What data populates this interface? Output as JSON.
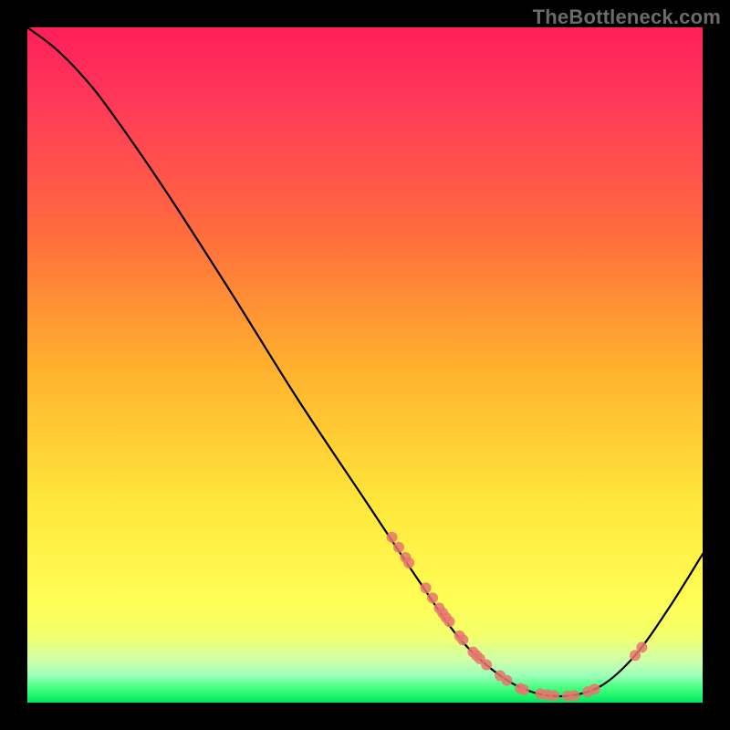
{
  "watermark": "TheBottleneck.com",
  "chart_data": {
    "type": "line",
    "title": "",
    "xlabel": "",
    "ylabel": "",
    "xlim": [
      0,
      100
    ],
    "ylim": [
      0,
      100
    ],
    "grid": false,
    "legend": false,
    "annotations": [],
    "curve_points": [
      {
        "x": 0,
        "y": 100
      },
      {
        "x": 4,
        "y": 97
      },
      {
        "x": 8,
        "y": 93
      },
      {
        "x": 12,
        "y": 88
      },
      {
        "x": 20,
        "y": 76.5
      },
      {
        "x": 30,
        "y": 61
      },
      {
        "x": 40,
        "y": 45
      },
      {
        "x": 50,
        "y": 30
      },
      {
        "x": 58,
        "y": 18
      },
      {
        "x": 64,
        "y": 9.5
      },
      {
        "x": 70,
        "y": 4
      },
      {
        "x": 75,
        "y": 1.5
      },
      {
        "x": 80,
        "y": 1.0
      },
      {
        "x": 85,
        "y": 2.5
      },
      {
        "x": 90,
        "y": 7
      },
      {
        "x": 95,
        "y": 14
      },
      {
        "x": 100,
        "y": 22
      }
    ],
    "highlight_dots": [
      {
        "x": 54,
        "y": 24.5
      },
      {
        "x": 55,
        "y": 23
      },
      {
        "x": 56,
        "y": 21.5
      },
      {
        "x": 56.5,
        "y": 20.7
      },
      {
        "x": 59,
        "y": 17
      },
      {
        "x": 60,
        "y": 15.5
      },
      {
        "x": 61,
        "y": 14
      },
      {
        "x": 61.5,
        "y": 13.3
      },
      {
        "x": 62,
        "y": 12.6
      },
      {
        "x": 62.5,
        "y": 12.0
      },
      {
        "x": 64,
        "y": 9.9
      },
      {
        "x": 64.5,
        "y": 9.3
      },
      {
        "x": 66,
        "y": 7.5
      },
      {
        "x": 66.5,
        "y": 7.0
      },
      {
        "x": 67,
        "y": 6.5
      },
      {
        "x": 68,
        "y": 5.6
      },
      {
        "x": 70,
        "y": 4.0
      },
      {
        "x": 71,
        "y": 3.3
      },
      {
        "x": 73,
        "y": 2.1
      },
      {
        "x": 73.5,
        "y": 1.9
      },
      {
        "x": 76,
        "y": 1.3
      },
      {
        "x": 77,
        "y": 1.15
      },
      {
        "x": 78,
        "y": 1.05
      },
      {
        "x": 80,
        "y": 1.0
      },
      {
        "x": 81,
        "y": 1.05
      },
      {
        "x": 83,
        "y": 1.6
      },
      {
        "x": 84,
        "y": 2.0
      },
      {
        "x": 90,
        "y": 7.0
      },
      {
        "x": 91,
        "y": 8.2
      }
    ],
    "colors": {
      "curve": "#000000",
      "dot": "#e8766e",
      "gradient_top": "#ff1f5a",
      "gradient_mid": "#ffe63a",
      "gradient_bottom": "#00e85c"
    }
  }
}
